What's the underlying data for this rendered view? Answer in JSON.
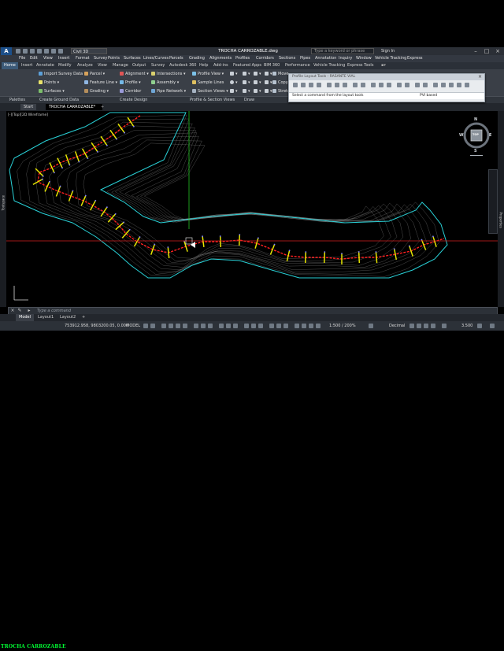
{
  "title_bar": {
    "app_button": "A",
    "workspace": "Civil 3D",
    "document_title": "TROCHA CARROZABLE.dwg",
    "search_placeholder": "Type a keyword or phrase",
    "sign_in": "Sign In",
    "window_controls": [
      "–",
      "□",
      "×"
    ]
  },
  "menu_bar": {
    "items": [
      "File",
      "Edit",
      "View",
      "Insert",
      "Format",
      "Survey",
      "Points",
      "Surfaces",
      "Lines/Curves",
      "Parcels",
      "Grading",
      "Alignments",
      "Profiles",
      "Corridors",
      "Sections",
      "Pipes",
      "Annotation",
      "Inquiry",
      "Window",
      "Vehicle Tracking",
      "Express"
    ]
  },
  "ribbon_tabs": {
    "items": [
      "Home",
      "Insert",
      "Annotate",
      "Modify",
      "Analyze",
      "View",
      "Manage",
      "Output",
      "Survey",
      "Autodesk 360",
      "Help",
      "Add-ins",
      "Featured Apps",
      "BIM 360",
      "Performance",
      "Vehicle Tracking",
      "Express Tools"
    ]
  },
  "ribbon": {
    "toolspace": "Toolspace",
    "items": [
      "Import Survey Data",
      "Points",
      "Surfaces",
      "Parcel",
      "Feature Line",
      "Grading",
      "Alignment",
      "Profile",
      "Corridor",
      "Intersections",
      "Assembly",
      "Pipe Network",
      "Profile View",
      "Sample Lines",
      "Section Views",
      "Move",
      "Copy",
      "Stretch"
    ]
  },
  "panel_bar": {
    "items": [
      "Palettes",
      "Create Ground Data",
      "Create Design",
      "Profile & Section Views",
      "Draw"
    ]
  },
  "layout_palette": {
    "title": "Profile Layout Tools - RASANTE VIAL",
    "prompt": "Select a command from the layout tools",
    "pvi_mode": "PVI based"
  },
  "file_tabs": [
    "Start",
    "TROCHA CARROZABLE*"
  ],
  "viewport_label": "[-][Top][2D Wireframe]",
  "palette_labels": {
    "left": "Toolspace",
    "right": "Properties"
  },
  "compass": {
    "n": "N",
    "s": "S",
    "e": "E",
    "w": "W",
    "cube": "TOP"
  },
  "command_line": {
    "placeholder": "Type a command"
  },
  "layout_tabs": [
    "Model",
    "Layout1",
    "Layout2",
    "+"
  ],
  "status_bar": {
    "coordinates": "753912.958, 9803200.05, 0.000",
    "space": "MODEL",
    "scale": "1:500 / 200%",
    "units": "Decimal",
    "value": "3.500"
  },
  "brand_overlay": "TROCHA CARROZABLE",
  "colors": {
    "boundary": "#29d0d6",
    "alignment": "#ff2020",
    "section_lines": "#e6e600",
    "contours": "#c8c8c8",
    "crosshair_v": "#22c422",
    "crosshair_h": "#d42020"
  }
}
